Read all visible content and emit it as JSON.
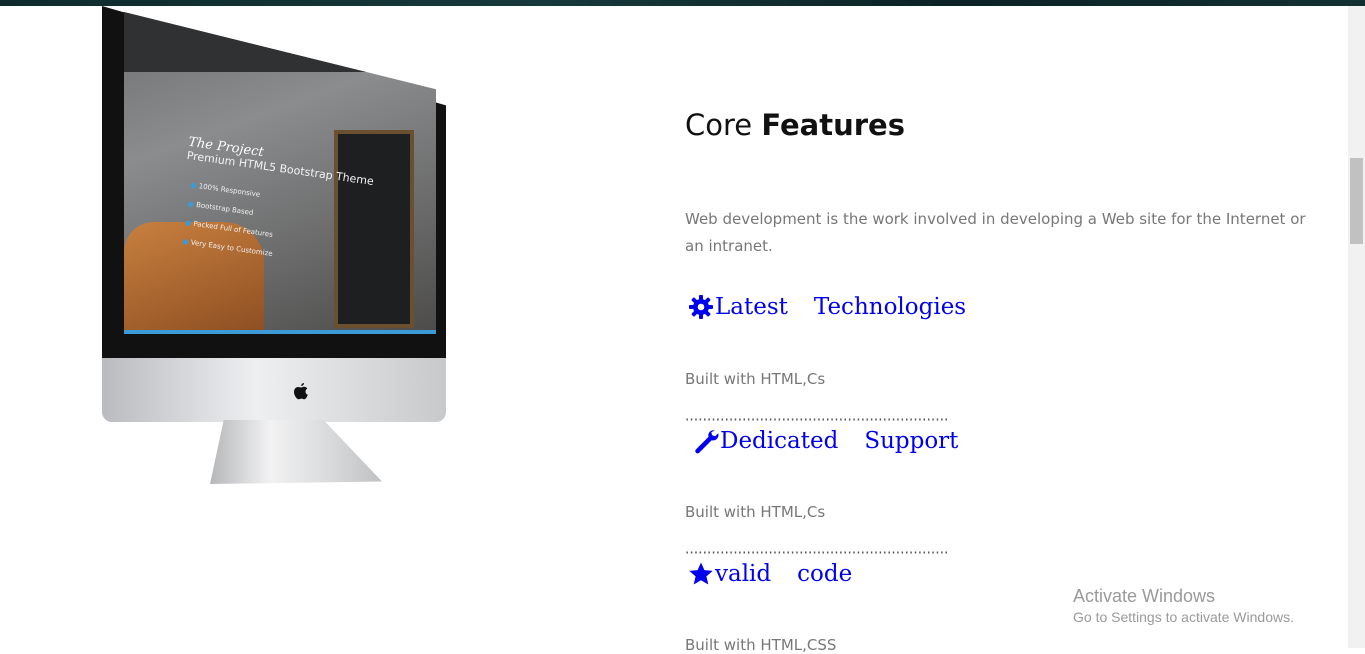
{
  "heading": {
    "light": "Core",
    "bold": "Features"
  },
  "intro": "Web development is the work involved in developing a Web site for the Internet or an intranet.",
  "features": [
    {
      "icon": "gear-icon",
      "word1": "Latest",
      "word2": "Technologies",
      "desc": "Built with HTML,Cs"
    },
    {
      "icon": "wrench-icon",
      "word1": "Dedicated",
      "word2": "Support",
      "desc": "Built with HTML,Cs"
    },
    {
      "icon": "star-icon",
      "word1": "valid",
      "word2": "code",
      "desc": "Built with HTML,CSS"
    }
  ],
  "mockup": {
    "screen_title": "The Project",
    "screen_subtitle": "Premium HTML5 Bootstrap Theme",
    "screen_items": [
      "100% Responsive",
      "Bootstrap Based",
      "Packed Full of Features",
      "Very Easy to Customize"
    ]
  },
  "watermark": {
    "title": "Activate Windows",
    "subtitle": "Go to Settings to activate Windows."
  },
  "colors": {
    "link": "#0000ee",
    "muted_text": "#777777",
    "heading": "#111111"
  }
}
